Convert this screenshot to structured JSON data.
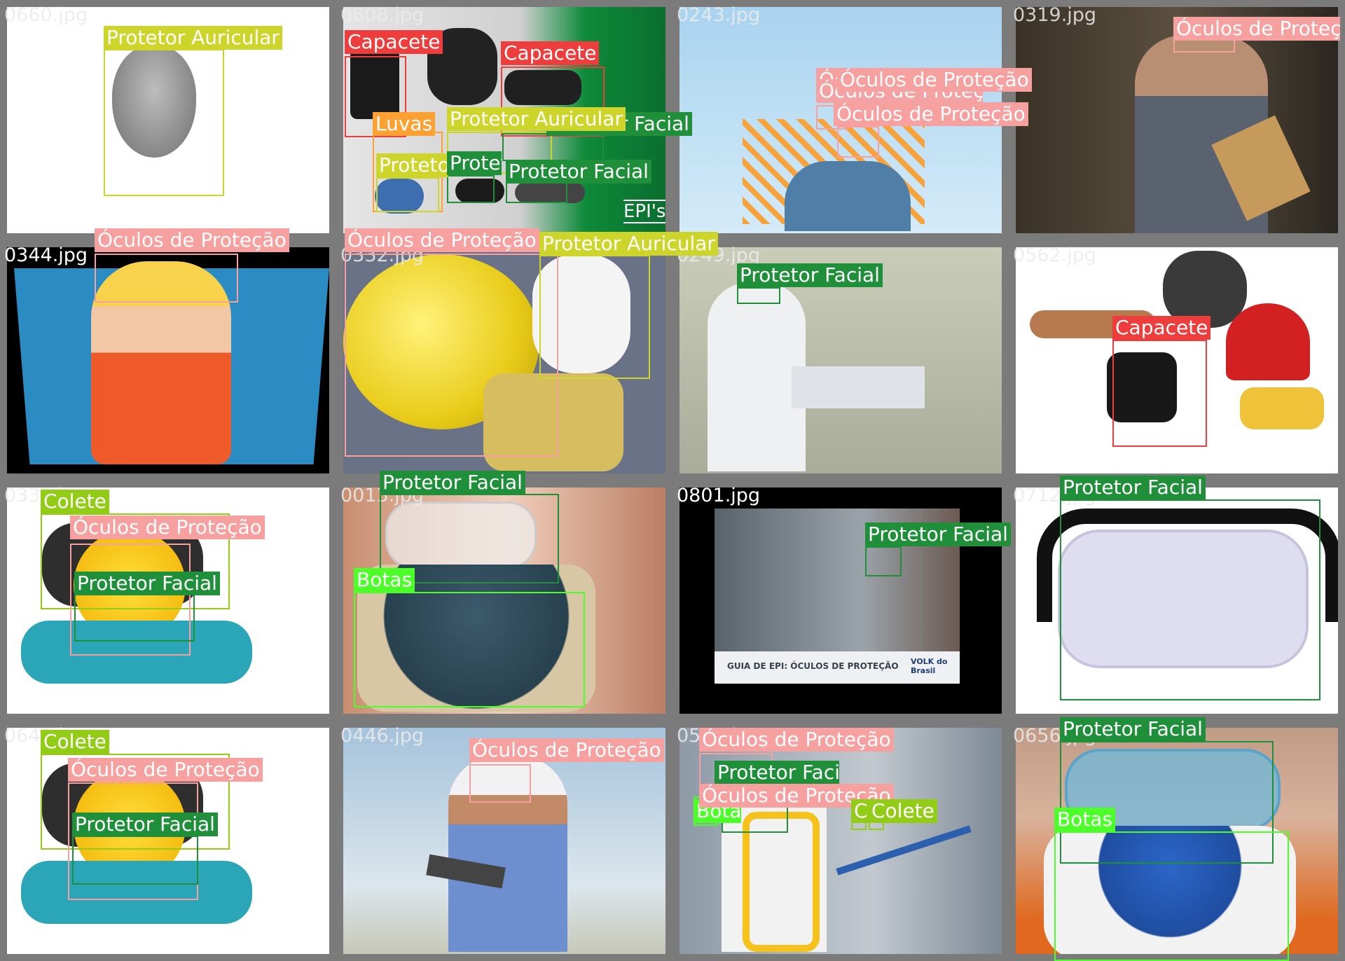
{
  "colors": {
    "Capacete": "#ee3d3d",
    "Luvas": "#ffa032",
    "Protetor Auricular": "#cdd52a",
    "Protetor Facial": "#1f8f3a",
    "Óculos de Proteção": "#f7a0a0",
    "Colete": "#92cc17",
    "Botas": "#4cff29"
  },
  "tiles": [
    {
      "file": "0660.jpg",
      "labels": [
        "Protetor Auricular"
      ]
    },
    {
      "file": "0608.jpg",
      "labels": [
        "Capacete",
        "Capacete",
        "Luvas",
        "Protetor Auricular",
        "Protetor Facial",
        "Protetor Facial",
        "Protetor Facial",
        "Protetor Auricular"
      ],
      "text": "EPI's"
    },
    {
      "file": "0243.jpg",
      "labels": [
        "Óculos de Proteção",
        "Óculos de Proteção",
        "Óculos de Proteção",
        "Óculos de Proteção"
      ]
    },
    {
      "file": "0319.jpg",
      "labels": [
        "Óculos de Proteção"
      ]
    },
    {
      "file": "0344.jpg",
      "labels": [
        "Óculos de Proteção"
      ]
    },
    {
      "file": "0332.jpg",
      "labels": [
        "Óculos de Proteção",
        "Protetor Auricular"
      ]
    },
    {
      "file": "0249.jpg",
      "labels": [
        "Protetor Facial"
      ]
    },
    {
      "file": "0562.jpg",
      "labels": [
        "Capacete"
      ]
    },
    {
      "file": "0333.jpg",
      "labels": [
        "Colete",
        "Óculos de Proteção",
        "Protetor Facial"
      ]
    },
    {
      "file": "0013.jpg",
      "labels": [
        "Protetor Facial",
        "Botas"
      ]
    },
    {
      "file": "0801.jpg",
      "labels": [
        "Protetor Facial"
      ],
      "text": "GUIA DE EPI: ÓCULOS DE PROTEÇÃO",
      "brand": "VOLK do Brasil"
    },
    {
      "file": "0712.jpg",
      "labels": [
        "Protetor Facial"
      ]
    },
    {
      "file": "0648.jpg",
      "labels": [
        "Colete",
        "Óculos de Proteção",
        "Protetor Facial"
      ]
    },
    {
      "file": "0446.jpg",
      "labels": [
        "Óculos de Proteção"
      ]
    },
    {
      "file": "0564.jpg",
      "labels": [
        "Óculos de Proteção",
        "Protetor Facial",
        "Óculos de Proteção",
        "Botas",
        "Colete",
        "Colete"
      ]
    },
    {
      "file": "0656.jpg",
      "labels": [
        "Protetor Facial",
        "Botas"
      ]
    }
  ]
}
